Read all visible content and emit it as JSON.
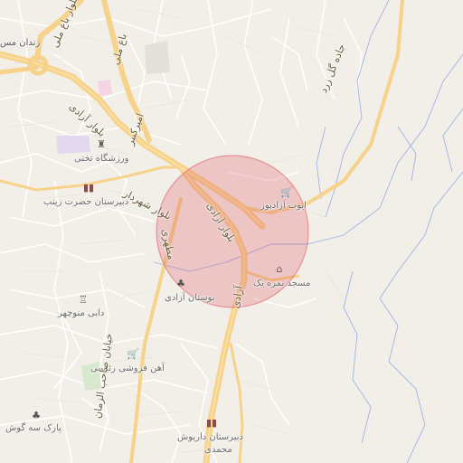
{
  "map": {
    "highlight_color": "#e05a66",
    "labels": {
      "zendan": "زندان مس",
      "bolvar_bagh_meli": "بلوار باغ ملی",
      "bagh_meli": "باغ ملی",
      "amir_kabir": "امیرکبیر",
      "bolvar_azadi_nw": "بلوار آزادی",
      "jadeh_gol": "جاده گل زرد",
      "varzeshgah": "ورزشگاه تختی",
      "dabirestan_zeinab": "دبیرستان حضرت زینب",
      "bolvar_shahrdar": "بلوار شهردار",
      "bolvar_azadi_center": "بلوار آزادی",
      "aboub_azadvar": "ایوب آزادپور",
      "motahhari": "مطهری",
      "masjed": "مسجد نمره یک",
      "bostan_azadi": "بوستان آزادی",
      "azadi_south": "آزادی",
      "dabi_manouchehr": "دابی منوچهر",
      "foroushi": "آهن فروشی رئیسی",
      "khiaban_saheb": "خیابان صاحب الزمان",
      "park": "پارک سه گوش",
      "dabirestan_dariush": "دبیرستان داریوش",
      "mohammadi": "محمدی"
    },
    "icons": {
      "shop": "cart-icon",
      "school": "school-icon",
      "mosque": "mosque-icon",
      "park": "tree-icon",
      "stadium": "stadium-icon",
      "tower": "tower-icon"
    }
  }
}
